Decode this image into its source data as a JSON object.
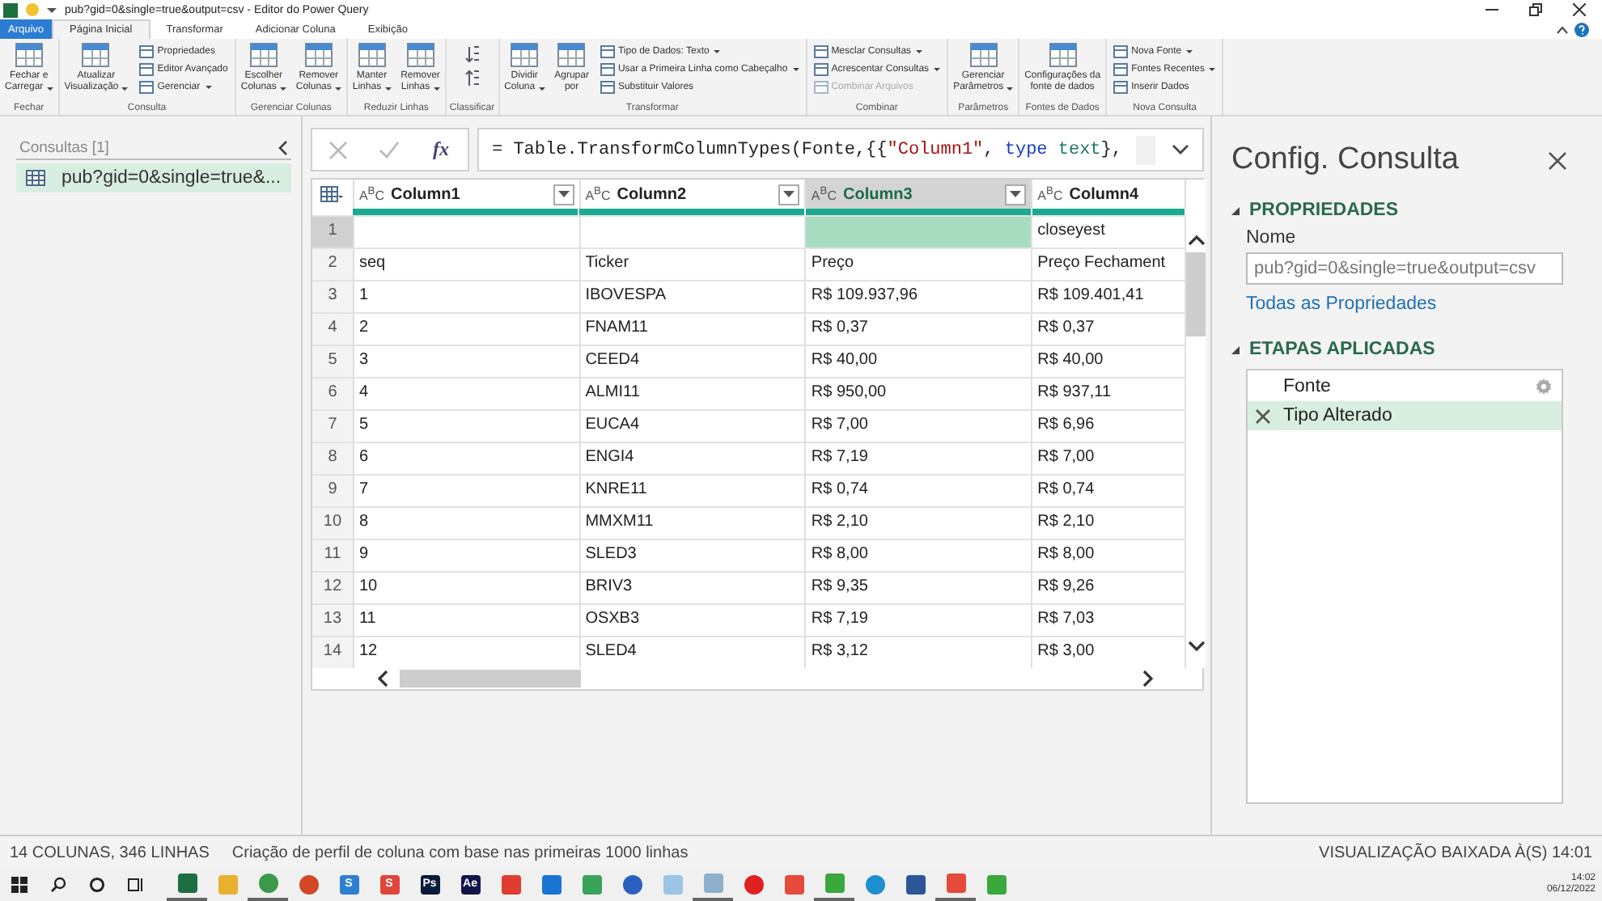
{
  "window": {
    "title": "pub?gid=0&single=true&output=csv - Editor do Power Query"
  },
  "menu_tabs": [
    {
      "label": "Arquivo",
      "kind": "file",
      "selected": false
    },
    {
      "label": "Página Inicial",
      "kind": "tab",
      "selected": true
    },
    {
      "label": "Transformar",
      "kind": "tab",
      "selected": false
    },
    {
      "label": "Adicionar Coluna",
      "kind": "tab",
      "selected": false
    },
    {
      "label": "Exibição",
      "kind": "tab",
      "selected": false
    }
  ],
  "ribbon": [
    {
      "label": "Fechar",
      "items": [
        {
          "kind": "large",
          "lines": [
            "Fechar e",
            "Carregar"
          ],
          "dropdown": true
        }
      ]
    },
    {
      "label": "Consulta",
      "items": [
        {
          "kind": "large",
          "lines": [
            "Atualizar",
            "Visualização"
          ],
          "dropdown": true
        },
        {
          "kind": "stack",
          "children": [
            {
              "label": "Propriedades",
              "dropdown": false,
              "disabled": false
            },
            {
              "label": "Editor Avançado",
              "dropdown": false,
              "disabled": false
            },
            {
              "label": "Gerenciar",
              "dropdown": true,
              "disabled": false
            }
          ]
        }
      ]
    },
    {
      "label": "Gerenciar Colunas",
      "items": [
        {
          "kind": "large",
          "lines": [
            "Escolher",
            "Colunas"
          ],
          "dropdown": true
        },
        {
          "kind": "large",
          "lines": [
            "Remover",
            "Colunas"
          ],
          "dropdown": true
        }
      ]
    },
    {
      "label": "Reduzir Linhas",
      "items": [
        {
          "kind": "large",
          "lines": [
            "Manter",
            "Linhas"
          ],
          "dropdown": true
        },
        {
          "kind": "large",
          "lines": [
            "Remover",
            "Linhas"
          ],
          "dropdown": true
        }
      ]
    },
    {
      "label": "Classificar",
      "items": [
        {
          "kind": "sort"
        }
      ]
    },
    {
      "label": "Transformar",
      "items": [
        {
          "kind": "large",
          "lines": [
            "Dividir",
            "Coluna"
          ],
          "dropdown": true
        },
        {
          "kind": "large",
          "lines": [
            "Agrupar",
            "por"
          ],
          "dropdown": false
        },
        {
          "kind": "stack",
          "children": [
            {
              "label": "Tipo de Dados: Texto",
              "dropdown": true,
              "disabled": false
            },
            {
              "label": "Usar a Primeira Linha como Cabeçalho",
              "dropdown": true,
              "disabled": false
            },
            {
              "label": "Substituir Valores",
              "dropdown": false,
              "disabled": false
            }
          ]
        }
      ]
    },
    {
      "label": "Combinar",
      "items": [
        {
          "kind": "stack",
          "children": [
            {
              "label": "Mesclar Consultas",
              "dropdown": true,
              "disabled": false
            },
            {
              "label": "Acrescentar Consultas",
              "dropdown": true,
              "disabled": false
            },
            {
              "label": "Combinar Arquivos",
              "dropdown": false,
              "disabled": true
            }
          ]
        }
      ]
    },
    {
      "label": "Parâmetros",
      "items": [
        {
          "kind": "large",
          "lines": [
            "Gerenciar",
            "Parâmetros"
          ],
          "dropdown": true
        }
      ]
    },
    {
      "label": "Fontes de Dados",
      "items": [
        {
          "kind": "large",
          "lines": [
            "Configurações da",
            "fonte de dados"
          ],
          "dropdown": false
        }
      ]
    },
    {
      "label": "Nova Consulta",
      "items": [
        {
          "kind": "stack",
          "children": [
            {
              "label": "Nova Fonte",
              "dropdown": true,
              "disabled": false
            },
            {
              "label": "Fontes Recentes",
              "dropdown": true,
              "disabled": false
            },
            {
              "label": "Inserir Dados",
              "dropdown": false,
              "disabled": false
            }
          ]
        }
      ]
    }
  ],
  "queries": {
    "title": "Consultas [1]",
    "items": [
      {
        "label": "pub?gid=0&single=true&...",
        "selected": true
      }
    ]
  },
  "formula": [
    {
      "kind": "plain",
      "text": "= Table.TransformColumnTypes(Fonte,{{"
    },
    {
      "kind": "string",
      "text": "\"Column1\""
    },
    {
      "kind": "plain",
      "text": ", "
    },
    {
      "kind": "keyword",
      "text": "type"
    },
    {
      "kind": "type",
      "text": "text"
    },
    {
      "kind": "plain",
      "text": "},"
    }
  ],
  "function_button": "fx",
  "table": {
    "columns": [
      {
        "name": "Column1",
        "type": "A$^{B}$C",
        "selected": false
      },
      {
        "name": "Column2",
        "type": "A$^{B}$C",
        "selected": false
      },
      {
        "name": "Column3",
        "type": "A$^{B}$C",
        "selected": true
      },
      {
        "name": "Column4",
        "type": "A$^{B}$C",
        "selected": false
      }
    ],
    "rows": [
      {
        "n": "1",
        "selected": true,
        "cells": [
          "",
          "",
          "",
          "closeyest"
        ]
      },
      {
        "n": "2",
        "selected": false,
        "cells": [
          "seq",
          "Ticker",
          "Preço",
          "Preço Fechament"
        ]
      },
      {
        "n": "3",
        "selected": false,
        "cells": [
          "1",
          "IBOVESPA",
          "R$ 109.937,96",
          "R$ 109.401,41"
        ]
      },
      {
        "n": "4",
        "selected": false,
        "cells": [
          "2",
          "FNAM11",
          "R$ 0,37",
          "R$ 0,37"
        ]
      },
      {
        "n": "5",
        "selected": false,
        "cells": [
          "3",
          "CEED4",
          "R$ 40,00",
          "R$ 40,00"
        ]
      },
      {
        "n": "6",
        "selected": false,
        "cells": [
          "4",
          "ALMI11",
          "R$ 950,00",
          "R$ 937,11"
        ]
      },
      {
        "n": "7",
        "selected": false,
        "cells": [
          "5",
          "EUCA4",
          "R$ 7,00",
          "R$ 6,96"
        ]
      },
      {
        "n": "8",
        "selected": false,
        "cells": [
          "6",
          "ENGI4",
          "R$ 7,19",
          "R$ 7,00"
        ]
      },
      {
        "n": "9",
        "selected": false,
        "cells": [
          "7",
          "KNRE11",
          "R$ 0,74",
          "R$ 0,74"
        ]
      },
      {
        "n": "10",
        "selected": false,
        "cells": [
          "8",
          "MMXM11",
          "R$ 2,10",
          "R$ 2,10"
        ]
      },
      {
        "n": "11",
        "selected": false,
        "cells": [
          "9",
          "SLED3",
          "R$ 8,00",
          "R$ 8,00"
        ]
      },
      {
        "n": "12",
        "selected": false,
        "cells": [
          "10",
          "BRIV3",
          "R$ 9,35",
          "R$ 9,26"
        ]
      },
      {
        "n": "13",
        "selected": false,
        "cells": [
          "11",
          "OSXB3",
          "R$ 7,19",
          "R$ 7,03"
        ]
      },
      {
        "n": "14",
        "selected": false,
        "cells": [
          "12",
          "SLED4",
          "R$ 3,12",
          "R$ 3,00"
        ]
      }
    ]
  },
  "settings": {
    "title": "Config. Consulta",
    "properties_heading": "PROPRIEDADES",
    "name_label": "Nome",
    "name_value": "pub?gid=0&single=true&output=csv",
    "all_properties_link": "Todas as Propriedades",
    "steps_heading": "ETAPAS APLICADAS",
    "steps": [
      {
        "label": "Fonte",
        "kind": "gear",
        "selected": false
      },
      {
        "label": "Tipo Alterado",
        "kind": "delete",
        "selected": true
      }
    ]
  },
  "status_bar": {
    "counts": "14 COLUNAS, 346 LINHAS",
    "profiling": "Criação de perfil de coluna com base nas primeiras 1000 linhas",
    "preview": "VISUALIZAÇÃO BAIXADA À(S) 14:01"
  },
  "taskbar": {
    "apps": [
      {
        "kind": "tile",
        "color": "#1d6f42",
        "active": true
      },
      {
        "kind": "tile",
        "color": "#e8b030",
        "active": false
      },
      {
        "kind": "round",
        "color": "#3a9a4a",
        "active": true
      },
      {
        "kind": "round",
        "color": "#d24726",
        "active": false
      },
      {
        "kind": "tile",
        "color": "#2f7fd0",
        "glyph": "S",
        "active": false
      },
      {
        "kind": "tile",
        "color": "#e2443a",
        "glyph": "S",
        "active": false
      },
      {
        "kind": "tile",
        "color": "#0a1a3a",
        "glyph": "Ps",
        "active": false
      },
      {
        "kind": "tile",
        "color": "#12154a",
        "glyph": "Ae",
        "active": false
      },
      {
        "kind": "tile",
        "color": "#e03c30",
        "active": false
      },
      {
        "kind": "tile",
        "color": "#1a75d2",
        "active": false
      },
      {
        "kind": "tile",
        "color": "#3aa35a",
        "active": false
      },
      {
        "kind": "round",
        "color": "#2a5fc0",
        "active": false
      },
      {
        "kind": "tile",
        "color": "#9cc4e4",
        "active": false
      },
      {
        "kind": "tile",
        "color": "#8fb0cc",
        "active": true
      },
      {
        "kind": "round",
        "color": "#e02020",
        "active": false
      },
      {
        "kind": "tile",
        "color": "#e54a3a",
        "active": false
      },
      {
        "kind": "tile",
        "color": "#3aa83a",
        "active": true
      },
      {
        "kind": "round",
        "color": "#1f8fd0",
        "active": false
      },
      {
        "kind": "tile",
        "color": "#2b5797",
        "active": false
      },
      {
        "kind": "tile",
        "color": "#e54a3a",
        "active": true
      },
      {
        "kind": "tile",
        "color": "#3aa83a",
        "active": false
      }
    ],
    "time": "14:02",
    "date": "06/12/2022"
  }
}
